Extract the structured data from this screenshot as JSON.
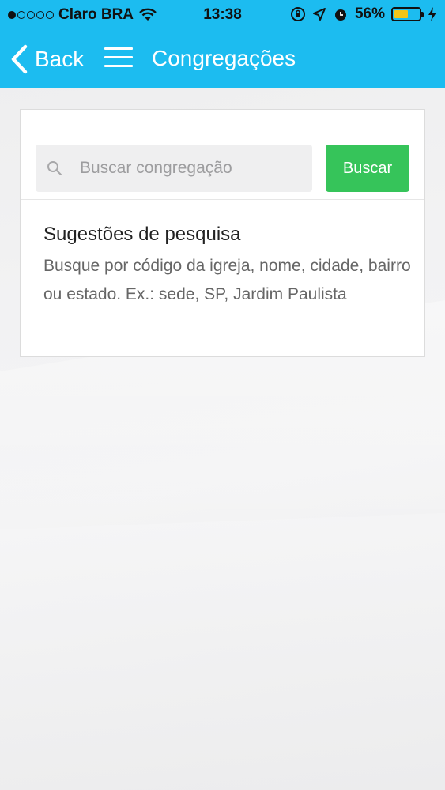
{
  "status_bar": {
    "carrier": "Claro BRA",
    "time": "13:38",
    "battery": "56%",
    "battery_level": 0.56,
    "icons": [
      "signal-dots-icon",
      "wifi-icon",
      "orientation-lock-icon",
      "location-arrow-icon",
      "alarm-icon",
      "battery-icon",
      "charging-bolt-icon"
    ]
  },
  "nav": {
    "back_label": "Back",
    "title": "Congregações",
    "menu_icon": "hamburger-menu-icon"
  },
  "search": {
    "placeholder": "Buscar congregação",
    "value": "",
    "button_label": "Buscar",
    "icon": "search-icon"
  },
  "suggestions": {
    "title": "Sugestões de pesquisa",
    "description": "Busque por código da igreja, nome, cidade, bairro ou estado. Ex.: sede, SP, Jardim Paulista"
  },
  "colors": {
    "header": "#1cbcf0",
    "button": "#36c45a",
    "battery": "#f5c518"
  }
}
